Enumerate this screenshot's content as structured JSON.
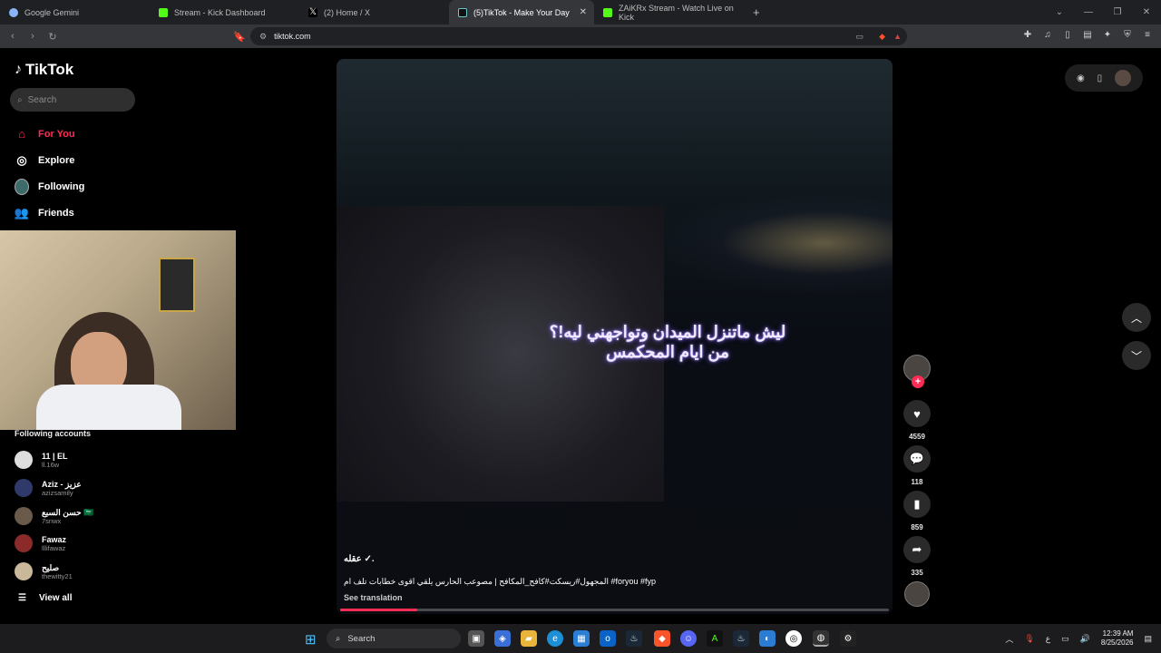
{
  "browser": {
    "tabs": [
      {
        "label": "Google Gemini",
        "color": "#8ab4f8"
      },
      {
        "label": "Stream - Kick Dashboard",
        "color": "#53fc18"
      },
      {
        "label": "(2) Home / X",
        "color": "#ffffff"
      },
      {
        "label": "(5)TikTok - Make Your Day",
        "color": "#ffffff"
      },
      {
        "label": "ZAiKRx Stream - Watch Live on Kick",
        "color": "#53fc18"
      }
    ],
    "new_tab_label": "+",
    "url": "tiktok.com"
  },
  "sidebar": {
    "logo_text": "TikTok",
    "search_placeholder": "Search",
    "nav": [
      {
        "label": "For You",
        "icon": "home-icon"
      },
      {
        "label": "Explore",
        "icon": "compass-icon"
      },
      {
        "label": "Following",
        "icon": "following-avatar-icon"
      },
      {
        "label": "Friends",
        "icon": "friends-icon"
      }
    ],
    "following_title": "Following accounts",
    "accounts": [
      {
        "name": "11 | EL",
        "handle": "ll.16w"
      },
      {
        "name": "Aziz - عزيز",
        "handle": "azizsamily"
      },
      {
        "name": "حسن السبع 🇸🇦",
        "handle": "7snwx"
      },
      {
        "name": "Fawaz",
        "handle": "lllifawaz"
      },
      {
        "name": "صليح",
        "handle": "thewitty21"
      }
    ],
    "view_all": "View all"
  },
  "video": {
    "headline_line1": "ليش ماتنزل الميدان وتواجهني ليه!؟",
    "headline_line2": "من ايام المحكمس",
    "username": "عقله ✓.",
    "caption": "المجهول#ريسكت#كافح_المكافح | مصوعب الحارس يلقي اقوى خطابات تلف ام #foryou #fyp",
    "see_translation": "See translation",
    "progress": 0.14
  },
  "actions": {
    "likes": "4559",
    "comments": "118",
    "saves": "859",
    "shares": "335"
  },
  "taskbar": {
    "search_label": "Search",
    "time": "12:39 AM",
    "date": "8/25/2026",
    "lang": "ع"
  }
}
